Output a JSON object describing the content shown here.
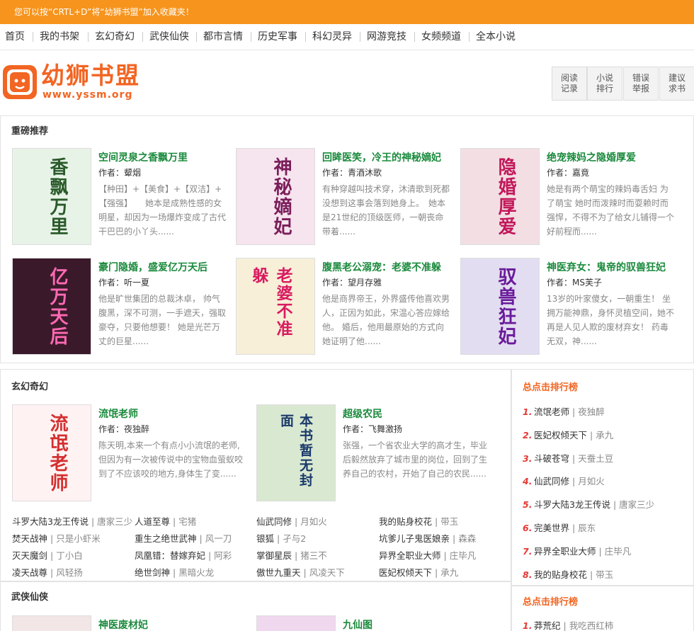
{
  "topbar": {
    "notice": "您可以按“CRTL+D”将“幼狮书盟”加入收藏夹！"
  },
  "nav": [
    "首页",
    "我的书架",
    "玄幻奇幻",
    "武侠仙侠",
    "都市言情",
    "历史军事",
    "科幻灵异",
    "网游竞技",
    "女频频道",
    "全本小说"
  ],
  "header": {
    "logo_title": "幼狮书盟",
    "logo_url": "www.yssm.org",
    "buttons": [
      {
        "l1": "阅读",
        "l2": "记录"
      },
      {
        "l1": "小说",
        "l2": "排行"
      },
      {
        "l1": "错误",
        "l2": "举报"
      },
      {
        "l1": "建议",
        "l2": "求书"
      }
    ]
  },
  "featured": {
    "title": "重磅推荐",
    "books": [
      {
        "title": "空间灵泉之香飘万里",
        "author": "作者：颦烟",
        "desc": "【种田】+【美食】+【双洁】+【强强】　　她本是成熟性感的女明星，却因为一场爆炸变成了古代干巴巴的小丫头......",
        "cover_text": "香飘万里",
        "cover_bg": "#e8f3e8",
        "cover_fg": "#2a5a2a"
      },
      {
        "title": "回眸医笑，冷王的神秘嫡妃",
        "author": "作者：青酒沐歌",
        "desc": "有种穿越叫技术穿，沐清歌到死都没想到这事会落到她身上。　她本是21世纪的顶级医师，一朝丧命带着......",
        "cover_text": "神秘嫡妃",
        "cover_bg": "#f6e4ee",
        "cover_fg": "#7a1e5a"
      },
      {
        "title": "绝宠辣妈之隐婚厚爱",
        "author": "作者：嘉竟",
        "desc": "她是有两个萌宝的辣妈毒舌妇 为了萌宝 她时而泼辣时而耍赖时而强悍，不得不为了给女儿铺得一个好前程而......",
        "cover_text": "隐婚厚爱",
        "cover_bg": "#f3dfe3",
        "cover_fg": "#c2185b"
      },
      {
        "title": "豪门隐婚，盛爱亿万天后",
        "author": "作者：听一夏",
        "desc": "他是旷世集团的总裁沐卓， 帅气腹黑，深不可测，一手遮天，强取豪夺，只要他想要！ 她是光芒万丈的巨星......",
        "cover_text": "亿万天后",
        "cover_bg": "#3a1a2a",
        "cover_fg": "#ff69b4"
      },
      {
        "title": "腹黑老公溺宠：老婆不准躲",
        "author": "作者：望月存雅",
        "desc": "他是商界帝王，外界盛传他喜欢男人，正因为如此，宋温心答应嫁给他。 婚后，他用最原始的方式向她证明了他......",
        "cover_text": "老婆不准躲",
        "cover_bg": "#f7efd8",
        "cover_fg": "#d81b60"
      },
      {
        "title": "神医弃女：鬼帝的驭兽狂妃",
        "author": "作者：MS芙子",
        "desc": "13岁的叶家傻女，一朝重生！ 坐拥万能神鼎，身怀灵植空间，她不再是人见人欺的废材弃女！ 药毒无双，神......",
        "cover_text": "驭兽狂妃",
        "cover_bg": "#e2ddf0",
        "cover_fg": "#6a1b9a"
      }
    ]
  },
  "xuanhuan": {
    "title": "玄幻奇幻",
    "books": [
      {
        "title": "流氓老师",
        "author": "作者：夜独醉",
        "desc": "陈天明,本来一个有点小小流氓的老师,但因为有一次被传说中的宝物血萤蚁咬到了不应该咬的地方,身体生了变......",
        "cover_text": "流氓老师",
        "cover_bg": "#fff2f2",
        "cover_fg": "#d32f2f"
      },
      {
        "title": "超级农民",
        "author": "作者：飞舞激扬",
        "desc": "张强，一个省农业大学的高才生，毕业后毅然放弃了城市里的岗位，回到了生养自己的农村，开始了自己的农民......",
        "cover_text": "本书暂无封面",
        "cover_bg": "#d9e8d0",
        "cover_fg": "#1b3a6b"
      }
    ],
    "list": [
      [
        {
          "t": "斗罗大陆3龙王传说",
          "a": "唐家三少"
        },
        {
          "t": "人道至尊",
          "a": "宅猪"
        },
        {
          "t": "仙武同修",
          "a": "月如火"
        },
        {
          "t": "我的贴身校花",
          "a": "带玉"
        }
      ],
      [
        {
          "t": "焚天战神",
          "a": "只是小虾米"
        },
        {
          "t": "重生之绝世武神",
          "a": "风一刀"
        },
        {
          "t": "银狐",
          "a": "孑与2"
        },
        {
          "t": "坑爹儿子鬼医娘亲",
          "a": "森森"
        }
      ],
      [
        {
          "t": "灭天魔剑",
          "a": "丁小白"
        },
        {
          "t": "凤凰错：替嫁弃妃",
          "a": "阿彩"
        },
        {
          "t": "掌御星辰",
          "a": "猪三不"
        },
        {
          "t": "异界全职业大师",
          "a": "庄毕凡"
        }
      ],
      [
        {
          "t": "凌天战尊",
          "a": "风轻扬"
        },
        {
          "t": "绝世剑神",
          "a": "黑暗火龙"
        },
        {
          "t": "傲世九重天",
          "a": "风凌天下"
        },
        {
          "t": "医妃权倾天下",
          "a": "承九"
        }
      ]
    ]
  },
  "rank1": {
    "title": "总点击排行榜",
    "items": [
      {
        "n": "1.",
        "t": "流氓老师",
        "a": "夜独醉"
      },
      {
        "n": "2.",
        "t": "医妃权倾天下",
        "a": "承九"
      },
      {
        "n": "3.",
        "t": "斗破苍穹",
        "a": "天蚕土豆"
      },
      {
        "n": "4.",
        "t": "仙武同修",
        "a": "月如火"
      },
      {
        "n": "5.",
        "t": "斗罗大陆3龙王传说",
        "a": "唐家三少"
      },
      {
        "n": "6.",
        "t": "完美世界",
        "a": "辰东"
      },
      {
        "n": "7.",
        "t": "异界全职业大师",
        "a": "庄毕凡"
      },
      {
        "n": "8.",
        "t": "我的贴身校花",
        "a": "带玉"
      }
    ]
  },
  "wuxia": {
    "title": "武侠仙侠",
    "books": [
      {
        "title": "神医废材妃",
        "cover_bg": "#f3e6e6"
      },
      {
        "title": "九仙图",
        "cover_bg": "#f0d8ee"
      }
    ]
  },
  "rank2": {
    "title": "总点击排行榜",
    "items": [
      {
        "n": "1.",
        "t": "莽荒纪",
        "a": "我吃西红柿"
      }
    ]
  }
}
